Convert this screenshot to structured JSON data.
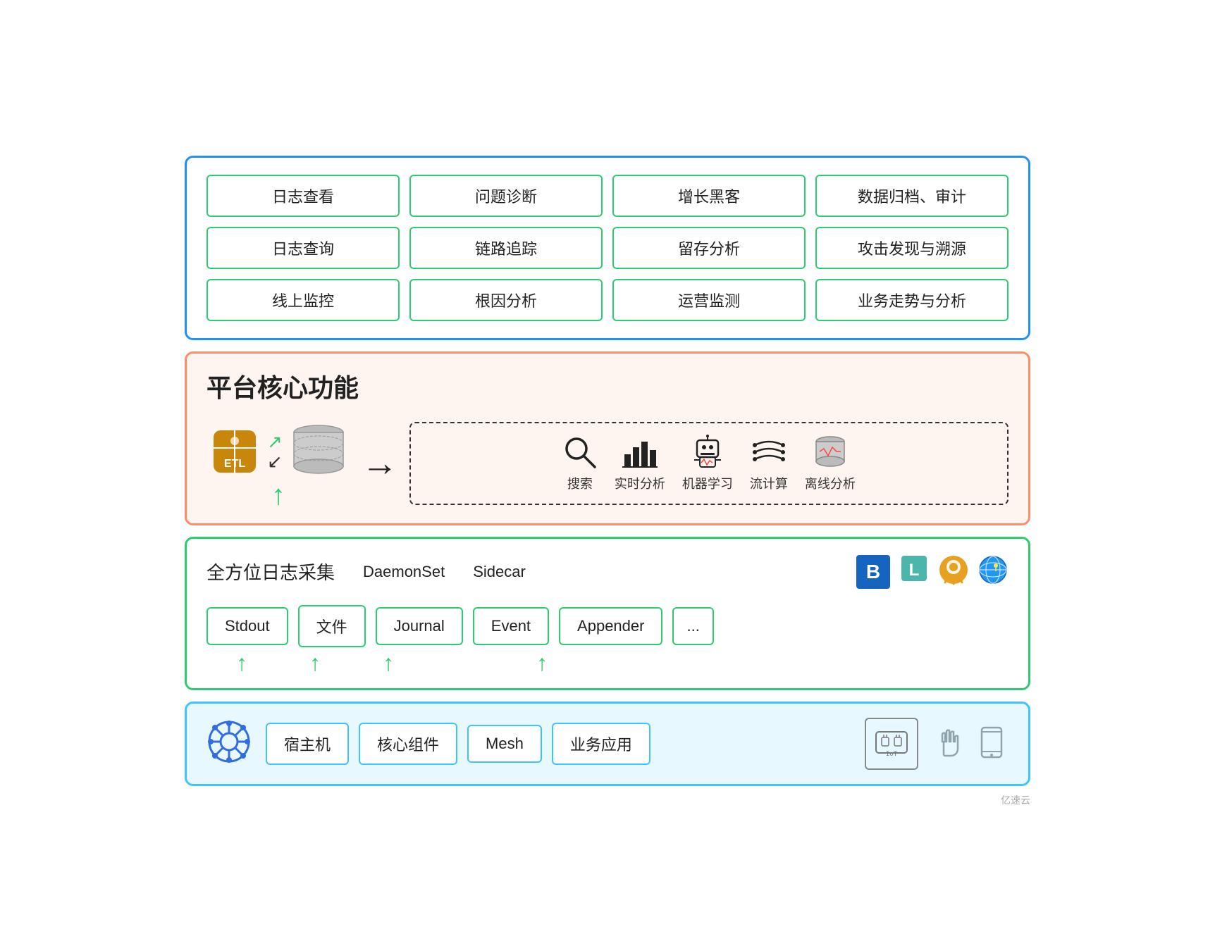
{
  "top_section": {
    "use_cases": [
      "日志查看",
      "问题诊断",
      "增长黑客",
      "数据归档、审计",
      "日志查询",
      "链路追踪",
      "留存分析",
      "攻击发现与溯源",
      "线上监控",
      "根因分析",
      "运营监测",
      "业务走势与分析"
    ]
  },
  "middle_section": {
    "title": "平台核心功能",
    "etl_label": "ETL",
    "analysis_items": [
      {
        "icon": "🔍",
        "label": "搜索"
      },
      {
        "icon": "📊",
        "label": "实时分析"
      },
      {
        "icon": "🤖",
        "label": "机器学习"
      },
      {
        "icon": "〰",
        "label": "流计算"
      },
      {
        "icon": "🗄",
        "label": "离线分析"
      }
    ]
  },
  "collection_section": {
    "title": "全方位日志采集",
    "daemon_label": "DaemonSet",
    "sidecar_label": "Sidecar",
    "sources": [
      "Stdout",
      "文件",
      "Journal",
      "Event",
      "Appender",
      "..."
    ]
  },
  "bottom_section": {
    "items": [
      "宿主机",
      "核心组件",
      "Mesh",
      "业务应用"
    ]
  },
  "watermark": "亿速云"
}
